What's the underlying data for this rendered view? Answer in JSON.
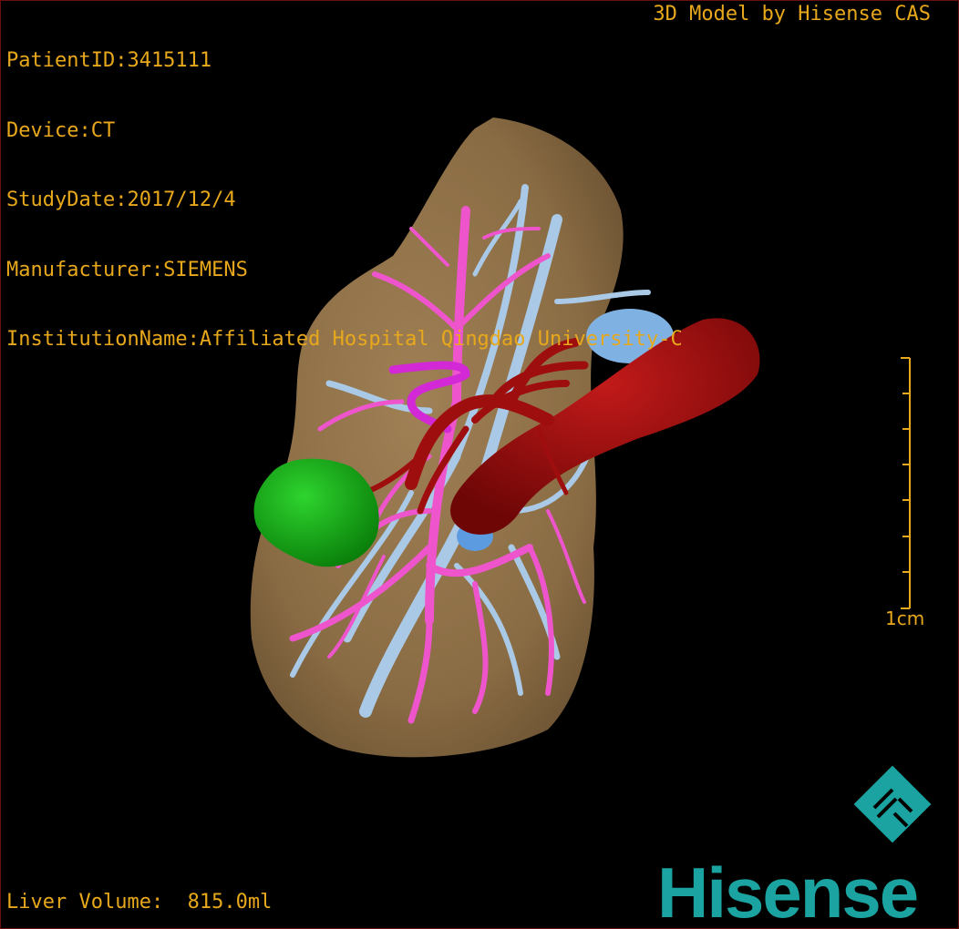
{
  "overlay": {
    "patient_id": "PatientID:3415111",
    "device": "Device:CT",
    "study_date": "StudyDate:2017/12/4",
    "manufacturer": "Manufacturer:SIEMENS",
    "institution": "InstitutionName:Affiliated Hospital Qingdao University-C",
    "model_credit": "3D Model by Hisense CAS",
    "liver_volume": "Liver Volume:  815.0ml"
  },
  "scale_bar": {
    "label": "1cm"
  },
  "brand": {
    "name": "Hisense"
  },
  "colors": {
    "text": "#e8a81c",
    "liver": "#8f7148",
    "portal_vein": "#ee55cc",
    "hepatic_vein": "#a9c9e6",
    "artery_ivc": "#a30f0f",
    "tumor": "#12a512",
    "brand": "#1aa3a0"
  }
}
